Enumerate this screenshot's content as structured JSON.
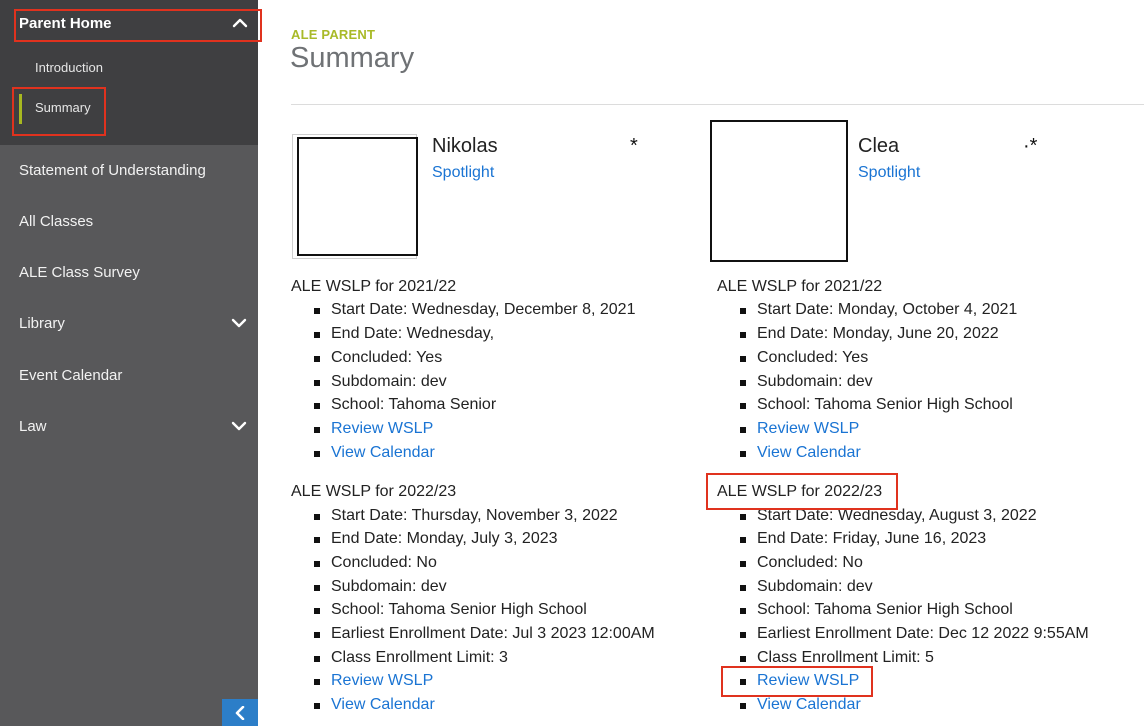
{
  "sidebar": {
    "header": "Parent Home",
    "sub_items": [
      "Introduction",
      "Summary"
    ],
    "items": [
      {
        "label": "Statement of Understanding",
        "has_chevron": false
      },
      {
        "label": "All Classes",
        "has_chevron": false
      },
      {
        "label": "ALE Class Survey",
        "has_chevron": false
      },
      {
        "label": "Library",
        "has_chevron": true
      },
      {
        "label": "Event Calendar",
        "has_chevron": false
      },
      {
        "label": "Law",
        "has_chevron": true
      }
    ]
  },
  "main": {
    "kicker": "ALE PARENT",
    "title": "Summary",
    "students": [
      {
        "name": "Nikolas",
        "link": "Spotlight",
        "mark": "*",
        "wslps": [
          {
            "title": "ALE WSLP for 2021/22",
            "details": [
              "Start Date: Wednesday, December 8, 2021",
              "End Date: Wednesday,",
              "Concluded: Yes",
              "Subdomain: dev",
              "School: Tahoma Senior"
            ],
            "links": [
              "Review WSLP",
              "View Calendar"
            ]
          },
          {
            "title": "ALE WSLP for 2022/23",
            "details": [
              "Start Date: Thursday, November 3, 2022",
              "End Date: Monday, July 3, 2023",
              "Concluded: No",
              "Subdomain: dev",
              "School: Tahoma Senior High School",
              "Earliest Enrollment Date: Jul 3 2023 12:00AM",
              "Class Enrollment Limit: 3"
            ],
            "links": [
              "Review WSLP",
              "View Calendar"
            ]
          }
        ]
      },
      {
        "name": "Clea",
        "link": "Spotlight",
        "mark": "·*",
        "wslps": [
          {
            "title": "ALE WSLP for 2021/22",
            "details": [
              "Start Date: Monday, October 4, 2021",
              "End Date: Monday, June 20, 2022",
              "Concluded: Yes",
              "Subdomain: dev",
              "School: Tahoma Senior High School"
            ],
            "links": [
              "Review WSLP",
              "View Calendar"
            ]
          },
          {
            "title": "ALE WSLP for 2022/23",
            "details": [
              "Start Date: Wednesday, August 3, 2022",
              "End Date: Friday, June 16, 2023",
              "Concluded: No",
              "Subdomain: dev",
              "School: Tahoma Senior High School",
              "Earliest Enrollment Date: Dec 12 2022 9:55AM",
              "Class Enrollment Limit: 5"
            ],
            "links": [
              "Review WSLP",
              "View Calendar"
            ]
          }
        ]
      }
    ]
  },
  "colors": {
    "sidebar_bg": "#58585a",
    "sidebar_active_bg": "#3f3f41",
    "accent": "#a9ba28",
    "link": "#1a74d3",
    "annotation": "#e0321e",
    "collapse_button": "#2c7ec8"
  },
  "icons": {
    "header_toggle": "chevron-up-icon",
    "item_expand": "chevron-down-icon",
    "collapse": "chevron-left-icon"
  }
}
